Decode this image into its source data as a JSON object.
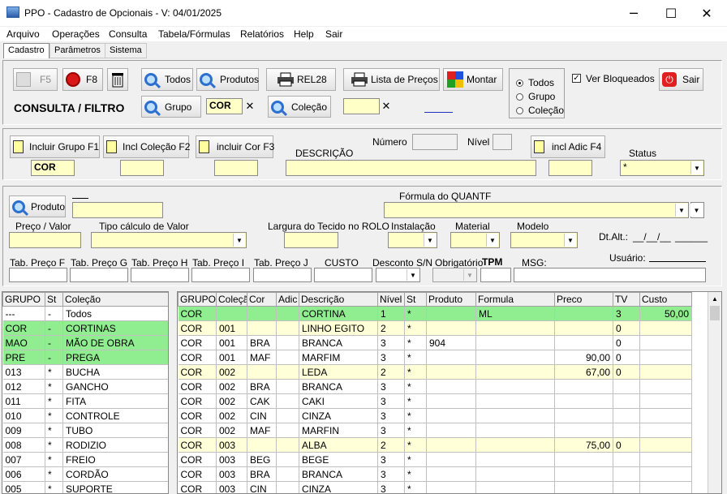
{
  "window": {
    "title": "PPO - Cadastro de Opcionais - V: 04/01/2025",
    "minimize": "─",
    "maximize": "☐",
    "close": "✕"
  },
  "menu": [
    "Arquivo",
    "Operações",
    "Consulta",
    "Tabela/Fórmulas",
    "Relatórios",
    "Help",
    "Sair"
  ],
  "tabs": [
    "Cadastro",
    "Parâmetros",
    "Sistema"
  ],
  "toolbar": {
    "f5": "F5",
    "f8": "F8",
    "todos": "Todos",
    "produtos": "Produtos",
    "rel28": "REL28",
    "lista": "Lista de Preços",
    "montar": "Montar",
    "sair": "Sair",
    "consulta_title": "CONSULTA / FILTRO",
    "grupo_btn": "Grupo",
    "grupo_value": "COR",
    "colecao_btn": "Coleção",
    "colecao_value": "",
    "radio": [
      "Todos",
      "Grupo",
      "Coleção"
    ],
    "radio_selected": "Todos",
    "ver_bloqueados": "Ver Bloqueados",
    "ver_bloqueados_checked": true
  },
  "inclusion": {
    "incluir_grupo": "Incluir Grupo F1",
    "incl_colecao": "Incl Coleção F2",
    "incluir_cor": "incluir Cor F3",
    "incl_adic": "incl Adic F4",
    "grupo_value": "COR",
    "descricao_label": "DESCRIÇÃO",
    "numero_label": "Número",
    "nivel_label": "Nível",
    "status_label": "Status",
    "status_value": "*"
  },
  "details": {
    "produto_btn": "Produto",
    "formula_label": "Fórmula do QUANTF",
    "preco_label": "Preço / Valor",
    "tipo_calc_label": "Tipo cálculo de Valor",
    "largura_label": "Largura do Tecido no ROLO",
    "instalacao_label": "Instalação",
    "material_label": "Material",
    "modelo_label": "Modelo",
    "dtalt_label": "Dt.Alt.:",
    "dtalt_value": "__/__/__",
    "dtalt_extra": "______",
    "tab_f": "Tab. Preço F",
    "tab_g": "Tab. Preço G",
    "tab_h": "Tab. Preço H",
    "tab_i": "Tab. Preço I",
    "tab_j": "Tab. Preço J",
    "custo": "CUSTO",
    "desconto": "Desconto S/N",
    "obrigatorio": "Obrigatório",
    "tpm": "TPM",
    "msg": "MSG:",
    "usuario": "Usuário:"
  },
  "left_grid": {
    "headers": [
      "GRUPO",
      "St",
      "Coleção"
    ],
    "rows": [
      {
        "c": [
          "---",
          "-",
          "Todos"
        ],
        "style": "white"
      },
      {
        "c": [
          "COR",
          "-",
          "CORTINAS"
        ],
        "style": "green"
      },
      {
        "c": [
          "MAO",
          "-",
          "MÃO DE OBRA"
        ],
        "style": "green"
      },
      {
        "c": [
          "PRE",
          "-",
          "PREGA"
        ],
        "style": "green"
      },
      {
        "c": [
          "013",
          "*",
          "BUCHA"
        ],
        "style": "white"
      },
      {
        "c": [
          "012",
          "*",
          "GANCHO"
        ],
        "style": "white"
      },
      {
        "c": [
          "011",
          "*",
          "FITA"
        ],
        "style": "white"
      },
      {
        "c": [
          "010",
          "*",
          "CONTROLE"
        ],
        "style": "white"
      },
      {
        "c": [
          "009",
          "*",
          "TUBO"
        ],
        "style": "white"
      },
      {
        "c": [
          "008",
          "*",
          "RODIZIO"
        ],
        "style": "white"
      },
      {
        "c": [
          "007",
          "*",
          "FREIO"
        ],
        "style": "white"
      },
      {
        "c": [
          "006",
          "*",
          "CORDÃO"
        ],
        "style": "white"
      },
      {
        "c": [
          "005",
          "*",
          "SUPORTE"
        ],
        "style": "white"
      }
    ]
  },
  "right_grid": {
    "headers": [
      "GRUPO",
      "Coleção",
      "Cor",
      "Adic",
      "Descrição",
      "Nível",
      "St",
      "Produto",
      "Formula",
      "Preco",
      "TV",
      "Custo"
    ],
    "rows": [
      {
        "c": [
          "COR",
          "",
          "",
          "",
          "CORTINA",
          "1",
          "*",
          "",
          "ML",
          "",
          "3",
          "50,00"
        ],
        "style": "green"
      },
      {
        "c": [
          "COR",
          "001",
          "",
          "",
          "LINHO EGITO",
          "2",
          "*",
          "",
          "",
          "",
          "0",
          ""
        ],
        "style": "yellow"
      },
      {
        "c": [
          "COR",
          "001",
          "BRA",
          "",
          "BRANCA",
          "3",
          "*",
          "904",
          "",
          "",
          "0",
          ""
        ],
        "style": "white"
      },
      {
        "c": [
          "COR",
          "001",
          "MAF",
          "",
          "MARFIM",
          "3",
          "*",
          "",
          "",
          "90,00",
          "0",
          ""
        ],
        "style": "white"
      },
      {
        "c": [
          "COR",
          "002",
          "",
          "",
          "LEDA",
          "2",
          "*",
          "",
          "",
          "67,00",
          "0",
          ""
        ],
        "style": "yellow"
      },
      {
        "c": [
          "COR",
          "002",
          "BRA",
          "",
          "BRANCA",
          "3",
          "*",
          "",
          "",
          "",
          "",
          ""
        ],
        "style": "white"
      },
      {
        "c": [
          "COR",
          "002",
          "CAK",
          "",
          "CAKI",
          "3",
          "*",
          "",
          "",
          "",
          "",
          ""
        ],
        "style": "white"
      },
      {
        "c": [
          "COR",
          "002",
          "CIN",
          "",
          "CINZA",
          "3",
          "*",
          "",
          "",
          "",
          "",
          ""
        ],
        "style": "white"
      },
      {
        "c": [
          "COR",
          "002",
          "MAF",
          "",
          "MARFIN",
          "3",
          "*",
          "",
          "",
          "",
          "",
          ""
        ],
        "style": "white"
      },
      {
        "c": [
          "COR",
          "003",
          "",
          "",
          "ALBA",
          "2",
          "*",
          "",
          "",
          "75,00",
          "0",
          ""
        ],
        "style": "yellow"
      },
      {
        "c": [
          "COR",
          "003",
          "BEG",
          "",
          "BEGE",
          "3",
          "*",
          "",
          "",
          "",
          "",
          ""
        ],
        "style": "white"
      },
      {
        "c": [
          "COR",
          "003",
          "BRA",
          "",
          "BRANCA",
          "3",
          "*",
          "",
          "",
          "",
          "",
          ""
        ],
        "style": "white"
      },
      {
        "c": [
          "COR",
          "003",
          "CIN",
          "",
          "CINZA",
          "3",
          "*",
          "",
          "",
          "",
          "",
          ""
        ],
        "style": "white"
      }
    ]
  }
}
